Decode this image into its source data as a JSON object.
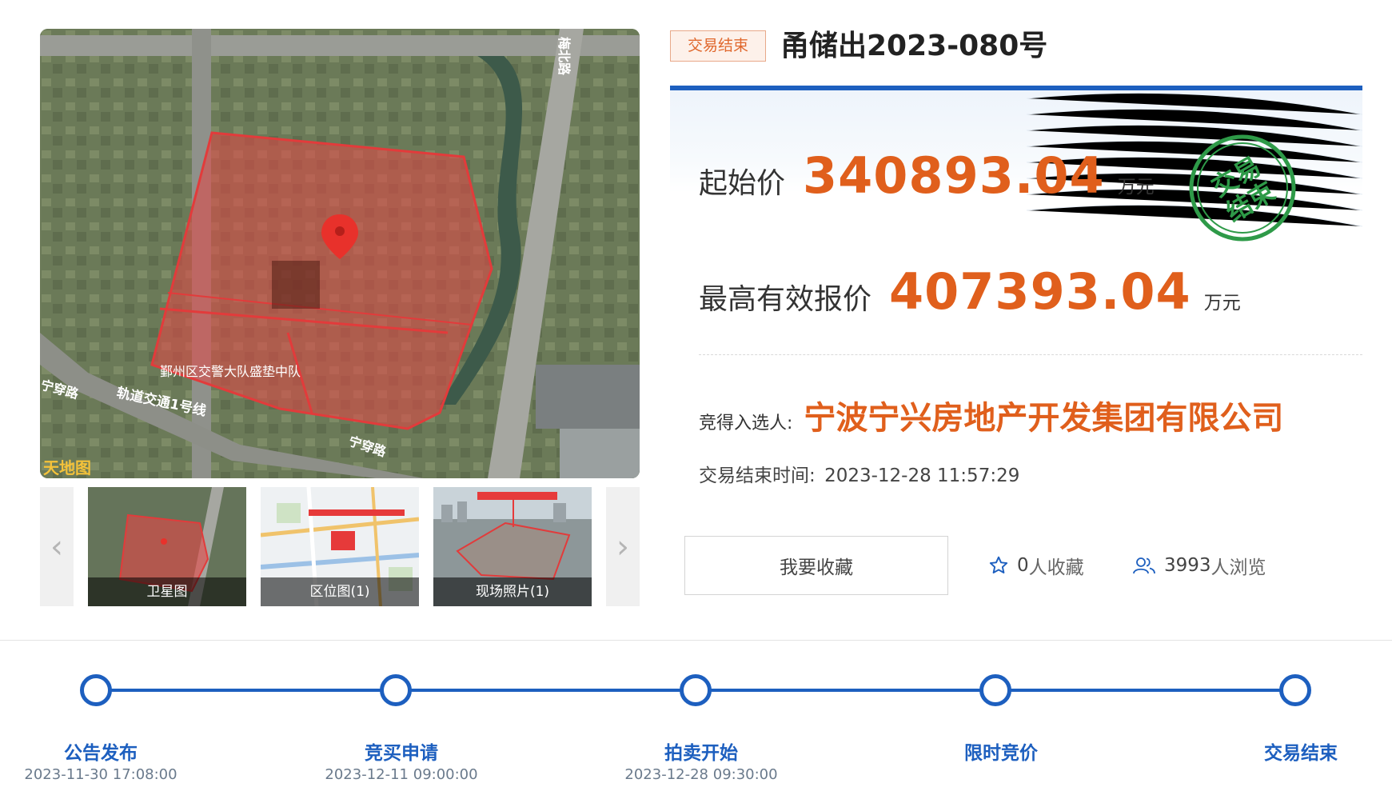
{
  "gallery": {
    "map_labels": {
      "road_top": "梅北路",
      "road_left": "宁穿路",
      "road_bottom": "宁穿路",
      "poi": "鄞州区交警大队盛垫中队",
      "metro": "轨道交通1号线",
      "logo": "天地图"
    },
    "thumbnails": [
      {
        "caption": "卫星图"
      },
      {
        "caption": "区位图(1)"
      },
      {
        "caption": "现场照片(1)"
      }
    ],
    "prev_icon": "chevron-left-icon",
    "next_icon": "chevron-right-icon"
  },
  "lot": {
    "status_tag": "交易结束",
    "title": "甬储出2023-080号"
  },
  "prices": {
    "start_label": "起始价",
    "start_value": "340893.04",
    "start_unit": "万元",
    "highest_label": "最高有效报价",
    "highest_value": "407393.04",
    "highest_unit": "万元"
  },
  "stamp": {
    "line1": "交易",
    "line2": "结束"
  },
  "winner": {
    "label": "竞得入选人:",
    "name": "宁波宁兴房地产开发集团有限公司"
  },
  "end_time": {
    "label": "交易结束时间:",
    "value": "2023-12-28 11:57:29"
  },
  "actions": {
    "favorite_button": "我要收藏",
    "favorites_count": "0",
    "favorites_suffix": "人收藏",
    "views_count": "3993",
    "views_suffix": "人浏览"
  },
  "timeline": [
    {
      "label": "公告发布",
      "time": "2023-11-30 17:08:00"
    },
    {
      "label": "竞买申请",
      "time": "2023-12-11 09:00:00"
    },
    {
      "label": "拍卖开始",
      "time": "2023-12-28 09:30:00"
    },
    {
      "label": "限时竞价",
      "time": ""
    },
    {
      "label": "交易结束",
      "time": ""
    }
  ],
  "colors": {
    "accent_blue": "#1d5fbf",
    "price_orange": "#e05f1c",
    "stamp_green": "#2e9a48"
  }
}
